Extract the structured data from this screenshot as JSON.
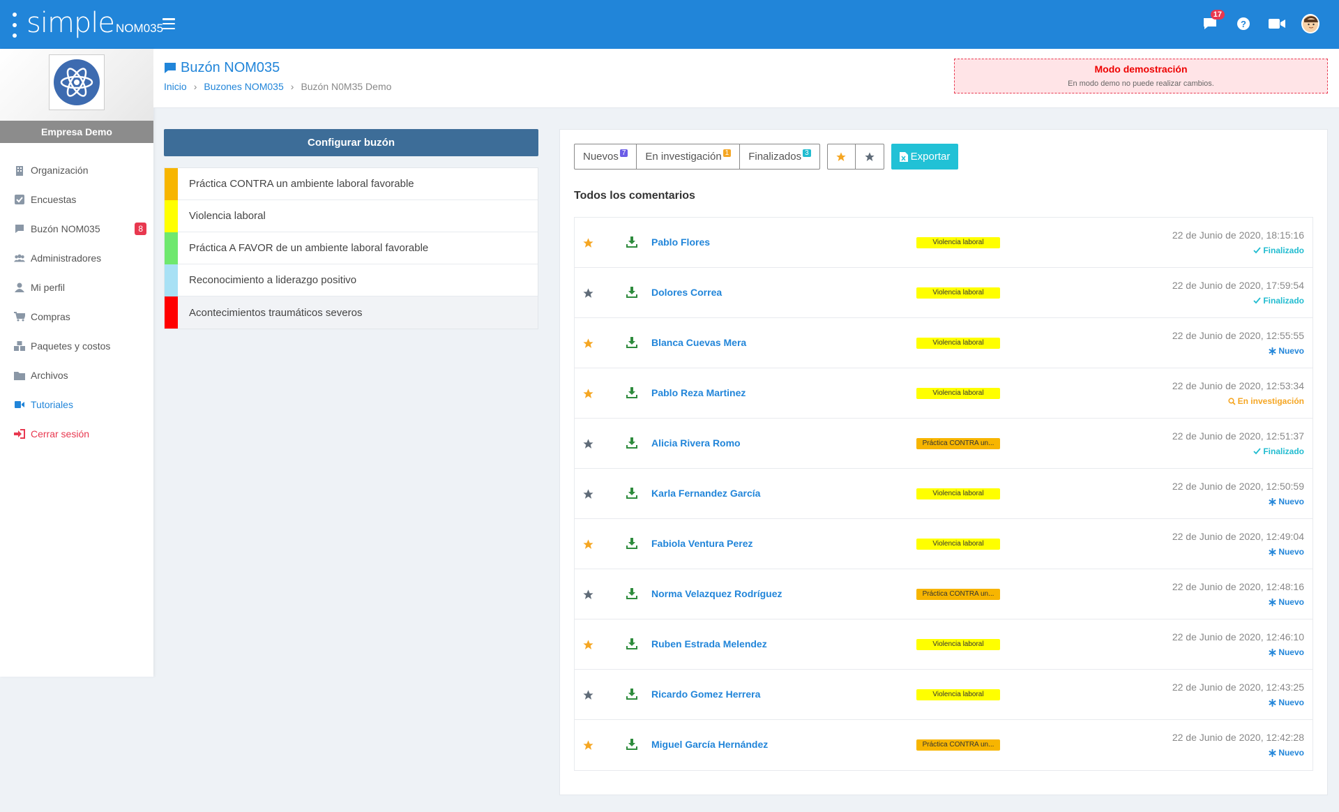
{
  "app": {
    "logo_main": "simple",
    "logo_sub": "NOM035",
    "notifications_count": "17"
  },
  "sidebar": {
    "company_name": "Empresa Demo",
    "items": [
      {
        "label": "Organización",
        "icon": "building-icon"
      },
      {
        "label": "Encuestas",
        "icon": "checkbox-icon"
      },
      {
        "label": "Buzón NOM035",
        "icon": "comment-icon",
        "badge": "8"
      },
      {
        "label": "Administradores",
        "icon": "users-icon"
      },
      {
        "label": "Mi perfil",
        "icon": "user-icon"
      },
      {
        "label": "Compras",
        "icon": "cart-icon"
      },
      {
        "label": "Paquetes y costos",
        "icon": "boxes-icon"
      },
      {
        "label": "Archivos",
        "icon": "folder-icon"
      },
      {
        "label": "Tutoriales",
        "icon": "video-icon"
      },
      {
        "label": "Cerrar sesión",
        "icon": "sign-out-icon"
      }
    ]
  },
  "header": {
    "title": "Buzón NOM035",
    "breadcrumb": [
      "Inicio",
      "Buzones NOM035",
      "Buzón N0M35 Demo"
    ],
    "demo_title": "Modo demostración",
    "demo_sub": "En modo demo no puede realizar cambios."
  },
  "left_panel": {
    "config_button": "Configurar buzón",
    "categories": [
      {
        "label": "Práctica CONTRA un ambiente laboral favorable",
        "color": "#f7b500"
      },
      {
        "label": "Violencia laboral",
        "color": "#ffff00"
      },
      {
        "label": "Práctica A FAVOR de un ambiente laboral favorable",
        "color": "#6ee86e"
      },
      {
        "label": "Reconocimiento a liderazgo positivo",
        "color": "#a8e1f5"
      },
      {
        "label": "Acontecimientos traumáticos severos",
        "color": "#ff0000"
      }
    ]
  },
  "filters": {
    "nuevos": "Nuevos",
    "nuevos_count": "7",
    "investigacion": "En investigación",
    "investigacion_count": "1",
    "finalizados": "Finalizados",
    "finalizados_count": "3",
    "export": "Exportar"
  },
  "list": {
    "title": "Todos los comentarios",
    "rows": [
      {
        "name": "Pablo Flores",
        "tag": "Violencia laboral",
        "tag_color": "#ffff00",
        "date": "22 de Junio de 2020, 18:15:16",
        "status": "Finalizado",
        "status_type": "done",
        "starred": true
      },
      {
        "name": "Dolores Correa",
        "tag": "Violencia laboral",
        "tag_color": "#ffff00",
        "date": "22 de Junio de 2020, 17:59:54",
        "status": "Finalizado",
        "status_type": "done",
        "starred": false
      },
      {
        "name": "Blanca Cuevas Mera",
        "tag": "Violencia laboral",
        "tag_color": "#ffff00",
        "date": "22 de Junio de 2020, 12:55:55",
        "status": "Nuevo",
        "status_type": "new",
        "starred": true
      },
      {
        "name": "Pablo Reza Martinez",
        "tag": "Violencia laboral",
        "tag_color": "#ffff00",
        "date": "22 de Junio de 2020, 12:53:34",
        "status": "En investigación",
        "status_type": "inv",
        "starred": true
      },
      {
        "name": "Alicia Rivera Romo",
        "tag": "Práctica CONTRA un...",
        "tag_color": "#f7b500",
        "date": "22 de Junio de 2020, 12:51:37",
        "status": "Finalizado",
        "status_type": "done",
        "starred": false
      },
      {
        "name": "Karla Fernandez García",
        "tag": "Violencia laboral",
        "tag_color": "#ffff00",
        "date": "22 de Junio de 2020, 12:50:59",
        "status": "Nuevo",
        "status_type": "new",
        "starred": false
      },
      {
        "name": "Fabiola Ventura Perez",
        "tag": "Violencia laboral",
        "tag_color": "#ffff00",
        "date": "22 de Junio de 2020, 12:49:04",
        "status": "Nuevo",
        "status_type": "new",
        "starred": true
      },
      {
        "name": "Norma Velazquez Rodríguez",
        "tag": "Práctica CONTRA un...",
        "tag_color": "#f7b500",
        "date": "22 de Junio de 2020, 12:48:16",
        "status": "Nuevo",
        "status_type": "new",
        "starred": false
      },
      {
        "name": "Ruben Estrada Melendez",
        "tag": "Violencia laboral",
        "tag_color": "#ffff00",
        "date": "22 de Junio de 2020, 12:46:10",
        "status": "Nuevo",
        "status_type": "new",
        "starred": true
      },
      {
        "name": "Ricardo Gomez Herrera",
        "tag": "Violencia laboral",
        "tag_color": "#ffff00",
        "date": "22 de Junio de 2020, 12:43:25",
        "status": "Nuevo",
        "status_type": "new",
        "starred": false
      },
      {
        "name": "Miguel García Hernández",
        "tag": "Práctica CONTRA un...",
        "tag_color": "#f7b500",
        "date": "22 de Junio de 2020, 12:42:28",
        "status": "Nuevo",
        "status_type": "new",
        "starred": true
      }
    ]
  },
  "colors": {
    "primary": "#2185d9",
    "star_on": "#f5a623",
    "star_off": "#5f6b78",
    "done": "#21bcd0",
    "new": "#2185d9",
    "inv": "#f5a623",
    "download": "#2e8b3d"
  }
}
